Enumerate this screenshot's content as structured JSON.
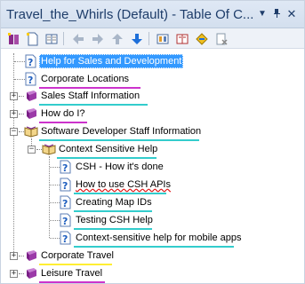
{
  "window": {
    "title": "Travel_the_Whirls (Default) - Table Of C..."
  },
  "toolbar": {
    "buttons": [
      "new-book-icon",
      "new-topic-icon",
      "properties-icon",
      "arrow-left-icon",
      "arrow-right-icon",
      "arrow-up-icon",
      "arrow-down-icon",
      "link-book-icon",
      "book-toc-icon",
      "diamond-icon",
      "delete-icon"
    ]
  },
  "tree": {
    "items": [
      {
        "label": "Help for Sales and Development",
        "type": "topic",
        "selected": true
      },
      {
        "label": "Corporate Locations",
        "type": "topic",
        "underline": "#cc33cc"
      },
      {
        "label": "Sales Staff Information",
        "type": "book",
        "underline": "#33cccc"
      },
      {
        "label": "How do I?",
        "type": "book",
        "underline": "#cc33cc"
      },
      {
        "label": "Software Developer Staff Information",
        "type": "book-open",
        "underline": "#33cccc"
      },
      {
        "label": "Context Sensitive Help",
        "type": "book-open"
      },
      {
        "label": "CSH - How it's done",
        "type": "topic"
      },
      {
        "label": "How to use CSH APIs",
        "type": "topic",
        "underline": "#33cccc",
        "squiggle_word": "APIs"
      },
      {
        "label": "Creating Map IDs",
        "type": "topic",
        "underline": "#33cccc"
      },
      {
        "label": "Testing CSH Help",
        "type": "topic",
        "underline": "#33cccc"
      },
      {
        "label": "Context-sensitive help for mobile apps",
        "type": "topic",
        "underline": "#33cccc"
      },
      {
        "label": "Corporate Travel",
        "type": "book",
        "underline": "#ffee33"
      },
      {
        "label": "Leisure Travel",
        "type": "book",
        "underline": "#cc33cc"
      }
    ]
  },
  "colors": {
    "selection": "#3399ff",
    "underline_magenta": "#cc33cc",
    "underline_cyan": "#33cccc",
    "underline_yellow": "#ffee33"
  }
}
